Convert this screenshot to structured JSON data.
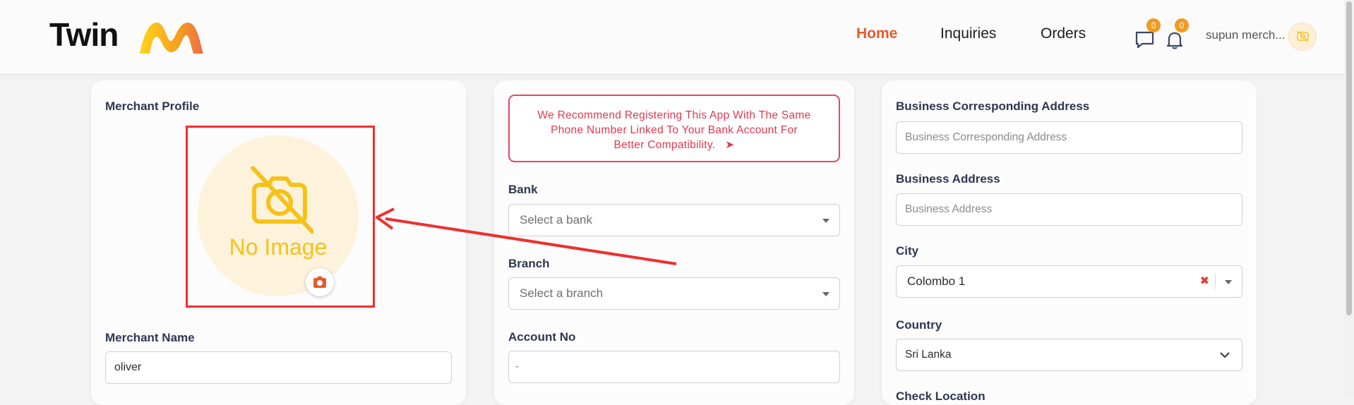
{
  "header": {
    "logo_text": "Twin",
    "nav": {
      "home": "Home",
      "inquiries": "Inquiries",
      "orders": "Orders"
    },
    "messages_count": "0",
    "notifications_count": "0",
    "user_name": "supun merch..."
  },
  "profile_card": {
    "title": "Merchant Profile",
    "no_image_text": "No Image",
    "merchant_name_label": "Merchant Name",
    "merchant_name_value": "oliver"
  },
  "bank_card": {
    "notice_line1": "We Recommend Registering This App With The Same",
    "notice_line2": "Phone Number Linked To Your Bank Account For",
    "notice_line3": "Better Compatibility.",
    "bank_label": "Bank",
    "bank_placeholder": "Select a bank",
    "branch_label": "Branch",
    "branch_placeholder": "Select a branch",
    "account_label": "Account No",
    "account_value": "-"
  },
  "address_card": {
    "corresponding_label": "Business Corresponding Address",
    "corresponding_placeholder": "Business Corresponding Address",
    "address_label": "Business Address",
    "address_placeholder": "Business Address",
    "city_label": "City",
    "city_value": "Colombo 1",
    "country_label": "Country",
    "country_value": "Sri Lanka",
    "check_location_label": "Check Location"
  },
  "colors": {
    "accent": "#e65a2f",
    "badge": "#f39a1f",
    "annotation": "#ee2f2f",
    "notice": "#e0384f"
  }
}
